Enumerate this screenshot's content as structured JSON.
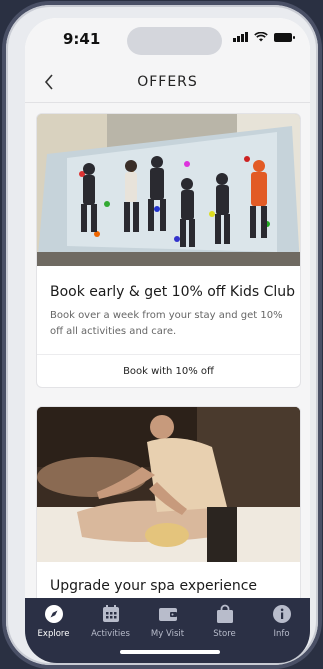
{
  "status": {
    "time": "9:41"
  },
  "nav": {
    "title": "OFFERS",
    "back_icon": "chevron-left-icon"
  },
  "offers": [
    {
      "title": "Book early & get 10% off Kids Club",
      "description": "Book over a week from your stay and get 10% off all activities and care.",
      "cta": "Book with 10% off",
      "image": "kids-climbing-wall-photo"
    },
    {
      "title": "Upgrade your spa experience",
      "image": "massage-spa-photo"
    }
  ],
  "tabs": [
    {
      "label": "Explore",
      "icon": "compass-icon",
      "active": true
    },
    {
      "label": "Activities",
      "icon": "calendar-icon",
      "active": false
    },
    {
      "label": "My Visit",
      "icon": "wallet-icon",
      "active": false
    },
    {
      "label": "Store",
      "icon": "shopping-bag-icon",
      "active": false
    },
    {
      "label": "Info",
      "icon": "info-icon",
      "active": false
    }
  ],
  "colors": {
    "tabbar": "#2b3045",
    "background": "#f5f5f6",
    "card": "#ffffff"
  }
}
